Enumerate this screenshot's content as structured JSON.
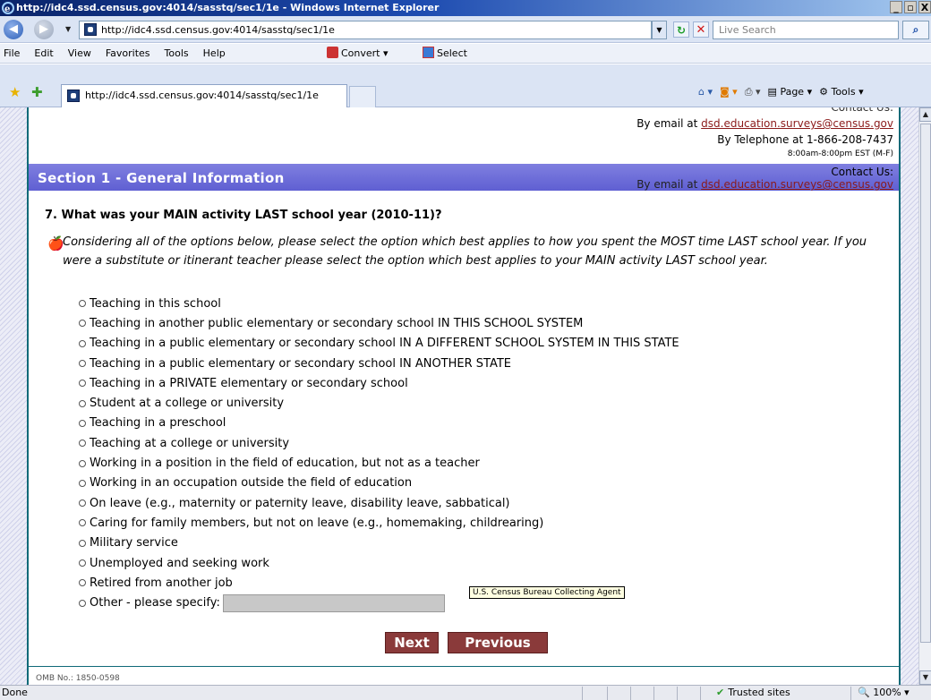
{
  "window": {
    "title": "http://idc4.ssd.census.gov:4014/sasstq/sec1/1e - Windows Internet Explorer",
    "min": "_",
    "max": "▫",
    "close": "X"
  },
  "address_bar": {
    "url": "http://idc4.ssd.census.gov:4014/sasstq/sec1/1e",
    "search_placeholder": "Live Search"
  },
  "menu": {
    "items": [
      "File",
      "Edit",
      "View",
      "Favorites",
      "Tools",
      "Help"
    ],
    "convert": "Convert",
    "select": "Select"
  },
  "tab": {
    "title": "http://idc4.ssd.census.gov:4014/sasstq/sec1/1e"
  },
  "command_bar": {
    "page": "Page",
    "tools": "Tools"
  },
  "contact_top": {
    "heading": "Contact Us:",
    "email_prefix": "By email at",
    "email": "dsd.education.surveys@census.gov",
    "phone": "By Telephone at 1-866-208-7437",
    "hours": "8:00am-8:00pm EST (M-F)"
  },
  "section": {
    "title": "Section 1 - General Information",
    "contact_heading": "Contact Us:",
    "email_prefix": "By email at",
    "email": "dsd.education.surveys@census.gov"
  },
  "question": {
    "text": "7. What was your MAIN activity LAST school year (2010-11)?",
    "instruction": "Considering all of the options below, please select the option which best applies to how you spent the MOST time LAST school year. If you were a substitute or itinerant teacher please select the option which best applies to your MAIN activity LAST school year.",
    "options": [
      "Teaching in this school",
      "Teaching in another public elementary or secondary school IN THIS SCHOOL SYSTEM",
      "Teaching in a public elementary or secondary school IN A DIFFERENT SCHOOL SYSTEM IN THIS STATE",
      "Teaching in a public elementary or secondary school IN ANOTHER STATE",
      "Teaching in a PRIVATE elementary or secondary school",
      "Student at a college or university",
      "Teaching in a preschool",
      "Teaching at a college or university",
      "Working in a position in the field of education, but not as a teacher",
      "Working in an occupation outside the field of education",
      "On leave (e.g., maternity or paternity leave, disability leave, sabbatical)",
      "Caring for family members, but not on leave (e.g., homemaking, childrearing)",
      "Military service",
      "Unemployed and seeking work",
      "Retired from another job",
      "Other - please specify:"
    ]
  },
  "tooltip": "U.S. Census Bureau Collecting Agent",
  "buttons": {
    "next": "Next",
    "previous": "Previous"
  },
  "footer": {
    "omb": "OMB No.: 1850-0598"
  },
  "status": {
    "left": "Done",
    "zone": "Trusted sites",
    "zoom": "100%"
  }
}
